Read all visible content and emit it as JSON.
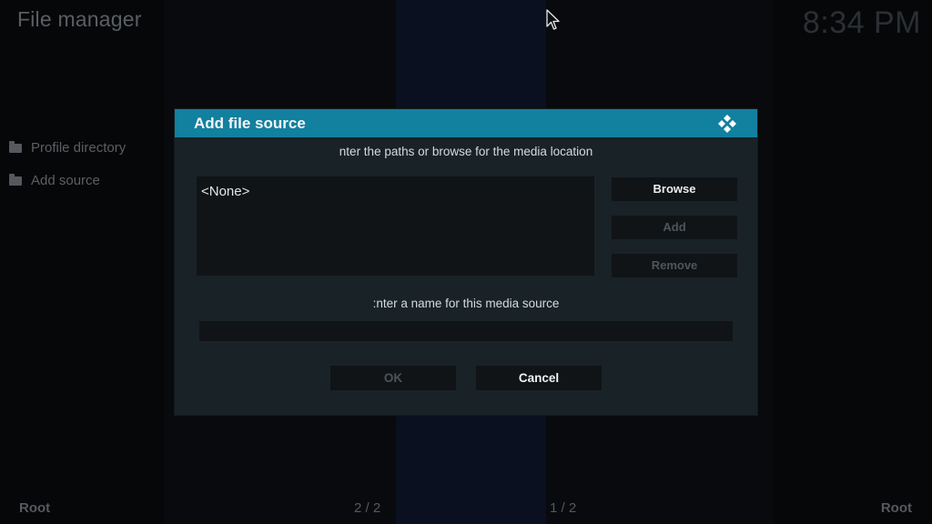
{
  "app": {
    "title": "File manager",
    "clock": "8:34 PM"
  },
  "sidebar": {
    "items": [
      {
        "label": "Profile directory",
        "icon": "folder-icon"
      },
      {
        "label": "Add source",
        "icon": "folder-icon"
      }
    ]
  },
  "footer": {
    "left_label": "Root",
    "left_page": "2 / 2",
    "right_page": "1 / 2",
    "right_label": "Root"
  },
  "dialog": {
    "title": "Add file source",
    "icon": "kodi-logo-icon",
    "paths_prompt": "nter the paths or browse for the media location",
    "paths": [
      "<None>"
    ],
    "buttons": {
      "browse": "Browse",
      "add": "Add",
      "remove": "Remove"
    },
    "name_prompt": ":nter a name for this media source",
    "name_value": "",
    "ok": "OK",
    "cancel": "Cancel"
  },
  "colors": {
    "accent": "#12809f",
    "dialog_bg": "#192227",
    "field_bg": "#101417"
  }
}
